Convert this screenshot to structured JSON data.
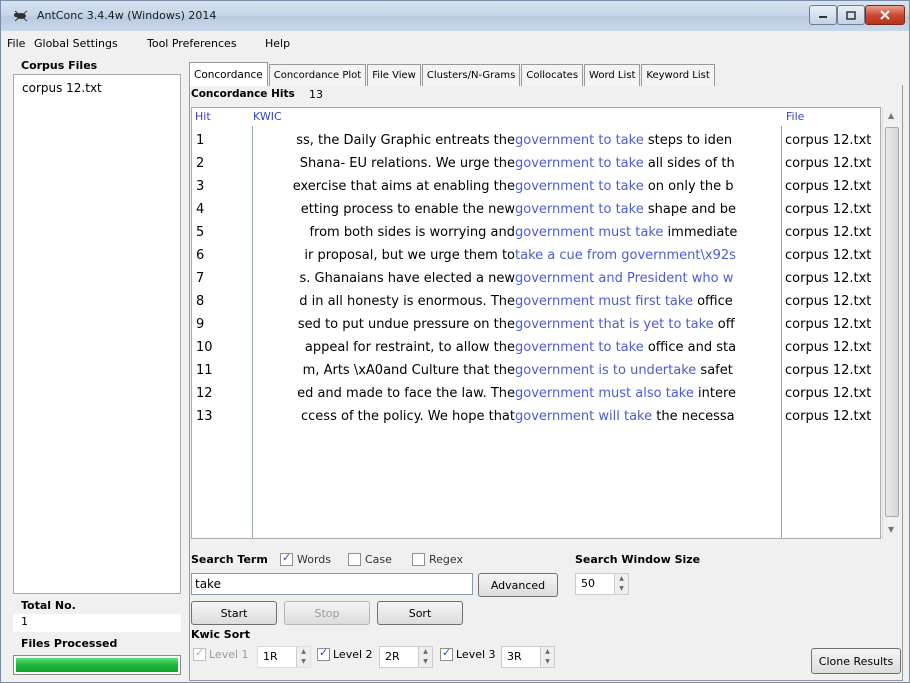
{
  "window": {
    "title": "AntConc 3.4.4w (Windows) 2014"
  },
  "menu": [
    "File",
    "Global Settings",
    "Tool Preferences",
    "Help"
  ],
  "left": {
    "corpus_files_label": "Corpus Files",
    "files": [
      "corpus 12.txt"
    ],
    "total_label": "Total No.",
    "total_value": "1",
    "processed_label": "Files Processed",
    "progress_percent": 100
  },
  "tabs": [
    {
      "label": "Concordance",
      "active": true
    },
    {
      "label": "Concordance Plot"
    },
    {
      "label": "File View"
    },
    {
      "label": "Clusters/N-Grams"
    },
    {
      "label": "Collocates"
    },
    {
      "label": "Word List"
    },
    {
      "label": "Keyword List"
    }
  ],
  "concordance": {
    "hits_label": "Concordance Hits",
    "hits_count": "13",
    "columns": {
      "hit": "Hit",
      "kwic": "KWIC",
      "file": "File"
    },
    "rows": [
      {
        "hit": "1",
        "left": "ss, the Daily Graphic entreats the ",
        "kw": "government to take",
        "right": " steps to iden",
        "file": "corpus 12.txt"
      },
      {
        "hit": "2",
        "left": "Shana- EU relations. We urge the ",
        "kw": "government to take",
        "right": " all sides of th",
        "file": "corpus 12.txt"
      },
      {
        "hit": "3",
        "left": "exercise that aims at enabling the ",
        "kw": "government to take",
        "right": " on only the b",
        "file": "corpus 12.txt"
      },
      {
        "hit": "4",
        "left": "etting process to enable the new ",
        "kw": "government to take",
        "right": " shape and be",
        "file": "corpus 12.txt"
      },
      {
        "hit": "5",
        "left": " from both sides is worrying and ",
        "kw": "government must take",
        "right": " immediate",
        "file": "corpus 12.txt"
      },
      {
        "hit": "6",
        "left": "ir proposal, but we urge them to ",
        "kw": "take a cue from government\\x92s",
        "right": "",
        "file": "corpus 12.txt"
      },
      {
        "hit": "7",
        "left": "s. Ghanaians have elected a new ",
        "kw": "government and President who w",
        "right": "",
        "file": "corpus 12.txt"
      },
      {
        "hit": "8",
        "left": "d in all honesty is enormous. The ",
        "kw": "government must first take",
        "right": " office",
        "file": "corpus 12.txt"
      },
      {
        "hit": "9",
        "left": "sed to put undue pressure on the ",
        "kw": "government that is yet to take",
        "right": " off",
        "file": "corpus 12.txt"
      },
      {
        "hit": "10",
        "left": " appeal for restraint, to allow the ",
        "kw": "government to take",
        "right": " office and sta",
        "file": "corpus 12.txt"
      },
      {
        "hit": "11",
        "left": "m, Arts \\xA0and Culture that the ",
        "kw": "government is to undertake",
        "right": " safet",
        "file": "corpus 12.txt"
      },
      {
        "hit": "12",
        "left": "ed and made to face the law. The ",
        "kw": "government must also take",
        "right": " intere",
        "file": "corpus 12.txt"
      },
      {
        "hit": "13",
        "left": "ccess of the policy. We hope that ",
        "kw": "government will take",
        "right": " the necessa",
        "file": "corpus 12.txt"
      }
    ],
    "colors": {
      "keyword": "#4d5bd6",
      "header": "#3344cc"
    }
  },
  "search": {
    "label": "Search Term",
    "options": [
      {
        "label": "Words",
        "checked": true
      },
      {
        "label": "Case",
        "checked": false
      },
      {
        "label": "Regex",
        "checked": false
      }
    ],
    "value": "take",
    "advanced_label": "Advanced",
    "window_size_label": "Search Window Size",
    "window_size": "50",
    "start_label": "Start",
    "stop_label": "Stop",
    "sort_label": "Sort"
  },
  "kwic_sort": {
    "label": "Kwic Sort",
    "levels": [
      {
        "label": "Level 1",
        "value": "1R",
        "checked": true,
        "enabled": false
      },
      {
        "label": "Level 2",
        "value": "2R",
        "checked": true,
        "enabled": true
      },
      {
        "label": "Level 3",
        "value": "3R",
        "checked": true,
        "enabled": true
      }
    ]
  },
  "clone_label": "Clone Results"
}
